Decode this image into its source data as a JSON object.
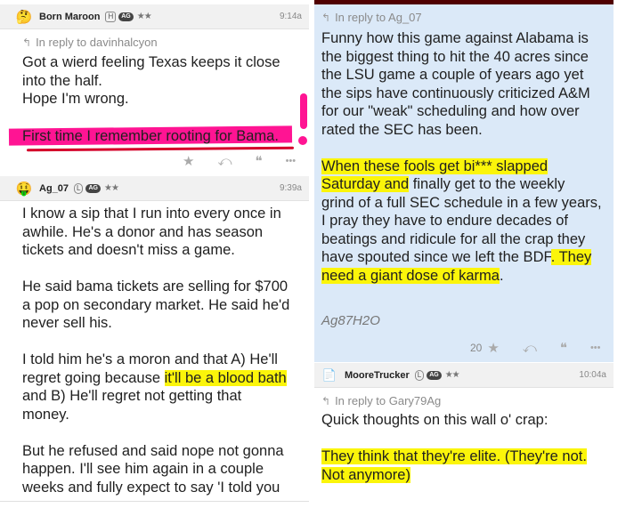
{
  "left": {
    "post1": {
      "user": "Born Maroon",
      "badge_h": "H",
      "badge_ag": "AG",
      "stars": "★★",
      "time": "9:14a",
      "reply_to": "In reply to davinhalcyon",
      "line1": "Got a wierd feeling Texas keeps it close",
      "line2": "into the half.",
      "line3": "Hope I'm wrong.",
      "line4": "First time I remember rooting for Bama."
    },
    "post2": {
      "user": "Ag_07",
      "badge_l": "L",
      "badge_ag": "AG",
      "stars": "★★",
      "time": "9:39a",
      "para1": "I know a sip that I run into every once in\nawhile. He's a donor and has season\ntickets and doesn't miss a game.",
      "para2": "He said bama tickets are selling for $700\na pop on secondary market. He said he'd\nnever sell his.",
      "para3a": "I told him he's a moron and that A) He'll\nregret going because ",
      "para3b": "it'll be a blood bath",
      "para3c": "\nand B) He'll regret not getting that\nmoney.",
      "para4": "But he refused and said nope not gonna\nhappen. I'll see him again in a couple\nweeks and fully expect to say 'I told you"
    }
  },
  "right": {
    "post1": {
      "reply_to": "In reply to Ag_07",
      "para1": "Funny how this game against Alabama is\nthe biggest thing to hit the 40 acres since\nthe LSU game a couple of years ago yet\nthe sips have continuously criticized A&M\nfor our \"weak\" scheduling and how over\nrated the SEC has been.",
      "para2a": "When these fools get bi*** slapped\nSaturday and",
      "para2b": " finally get to the weekly\ngrind of a full SEC schedule in a few years,\nI pray they have to endure decades of\nbeatings and ridicule for all the crap they\nhave spouted since we left the BDF",
      "para2c": ". They\nneed a giant dose of karma",
      "para2d": ".",
      "signature": "Ag87H2O",
      "star_count": "20"
    },
    "post2": {
      "user": "MooreTrucker",
      "badge_l": "L",
      "badge_ag": "AG",
      "stars": "★★",
      "time": "10:04a",
      "reply_to": "In reply to Gary79Ag",
      "line1": "Quick thoughts on this wall o' crap:",
      "line2": "They think that they're elite. (They're not.\nNot anymore)"
    }
  },
  "colors": {
    "maroon": "#500000",
    "yellow_highlight": "#fbf50a",
    "pink_highlight": "#ff1493",
    "blue_panel": "#dbe9f8"
  },
  "icons": {
    "star": "★",
    "reply": "⤺",
    "quote": "❝",
    "more": "•••",
    "reply_arrow": "↰"
  }
}
